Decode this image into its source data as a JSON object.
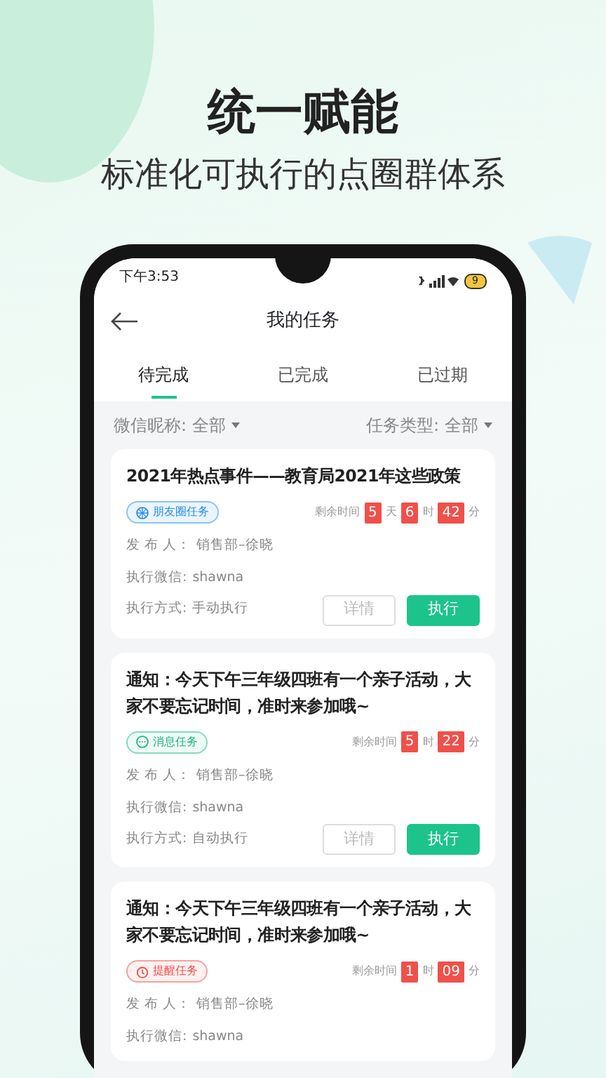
{
  "headline": "统一赋能",
  "subheadline": "标准化可执行的点圈群体系",
  "status_bar": {
    "time": "下午3:53",
    "battery": "9"
  },
  "header": {
    "title": "我的任务"
  },
  "tabs": [
    {
      "label": "待完成",
      "selected": true
    },
    {
      "label": "已完成",
      "selected": false
    },
    {
      "label": "已过期",
      "selected": false
    }
  ],
  "filters": [
    {
      "label": "微信昵称:",
      "value": "全部"
    },
    {
      "label": "任务类型:",
      "value": "全部"
    }
  ],
  "tasks": [
    {
      "title": "2021年热点事件——教育局2021年这些政策",
      "tag": {
        "kind": "moments",
        "label": "朋友圈任务"
      },
      "remaining_label": "剩余时间",
      "remaining": [
        {
          "value": "5",
          "unit": "天"
        },
        {
          "value": "6",
          "unit": "时"
        },
        {
          "value": "42",
          "unit": "分"
        }
      ],
      "fields": [
        {
          "label": "发 布 人：",
          "value": "销售部–徐晓"
        },
        {
          "label": "执行微信:",
          "value": "shawna"
        },
        {
          "label": "执行方式:",
          "value": "手动执行"
        }
      ],
      "buttons": [
        "详情",
        "执行"
      ]
    },
    {
      "title": "通知：今天下午三年级四班有一个亲子活动，大家不要忘记时间，准时来参加哦~",
      "tag": {
        "kind": "message",
        "label": "消息任务"
      },
      "remaining_label": "剩余时间",
      "remaining": [
        {
          "value": "5",
          "unit": "时"
        },
        {
          "value": "22",
          "unit": "分"
        }
      ],
      "fields": [
        {
          "label": "发 布 人：",
          "value": "销售部–徐晓"
        },
        {
          "label": "执行微信:",
          "value": "shawna"
        },
        {
          "label": "执行方式:",
          "value": "自动执行"
        }
      ],
      "buttons": [
        "详情",
        "执行"
      ]
    },
    {
      "title": "通知：今天下午三年级四班有一个亲子活动，大家不要忘记时间，准时来参加哦~",
      "tag": {
        "kind": "reminder",
        "label": "提醒任务"
      },
      "remaining_label": "剩余时间",
      "remaining": [
        {
          "value": "1",
          "unit": "时"
        },
        {
          "value": "09",
          "unit": "分"
        }
      ],
      "fields": [
        {
          "label": "发 布 人：",
          "value": "销售部–徐晓"
        },
        {
          "label": "执行微信:",
          "value": "shawna"
        }
      ]
    }
  ]
}
